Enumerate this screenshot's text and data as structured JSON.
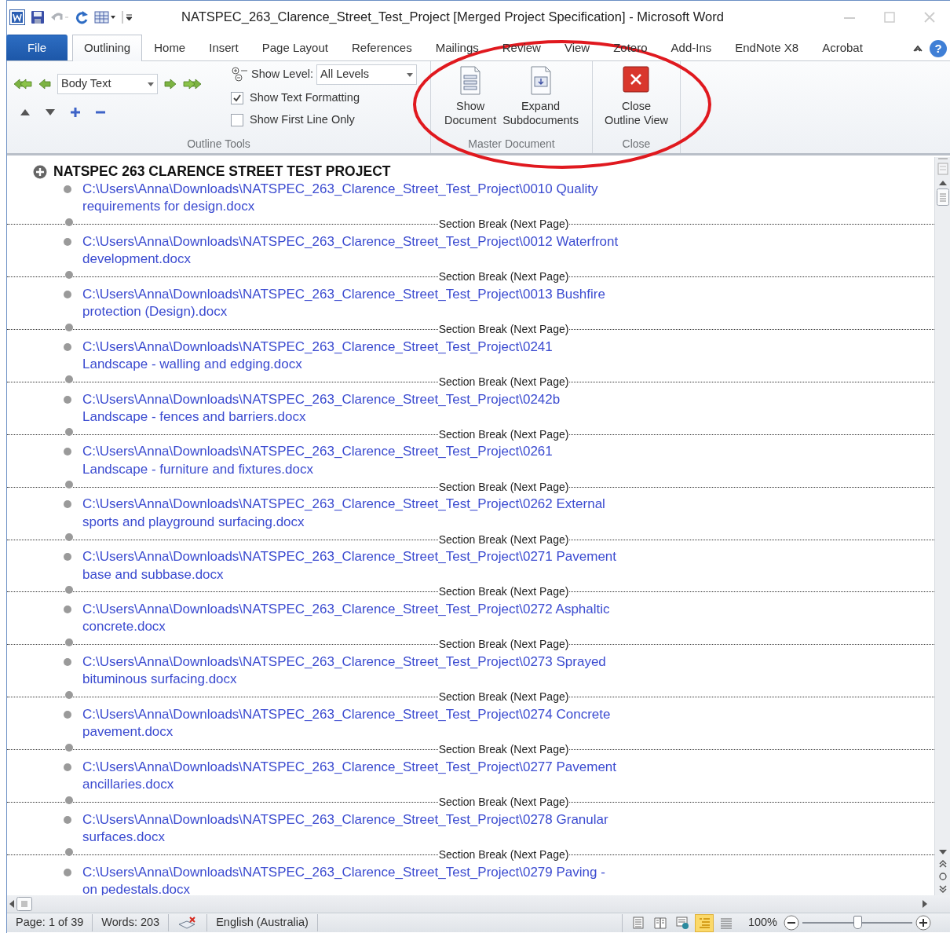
{
  "window": {
    "title": "NATSPEC_263_Clarence_Street_Test_Project [Merged Project Specification]  -  Microsoft Word"
  },
  "tabs": [
    {
      "label": "File",
      "kind": "file",
      "selected": false
    },
    {
      "label": "Outlining",
      "kind": "tab",
      "selected": true
    },
    {
      "label": "Home",
      "kind": "tab",
      "selected": false
    },
    {
      "label": "Insert",
      "kind": "tab",
      "selected": false
    },
    {
      "label": "Page Layout",
      "kind": "tab",
      "selected": false
    },
    {
      "label": "References",
      "kind": "tab",
      "selected": false
    },
    {
      "label": "Mailings",
      "kind": "tab",
      "selected": false
    },
    {
      "label": "Review",
      "kind": "tab",
      "selected": false
    },
    {
      "label": "View",
      "kind": "tab",
      "selected": false
    },
    {
      "label": "Zotero",
      "kind": "tab",
      "selected": false
    },
    {
      "label": "Add-Ins",
      "kind": "tab",
      "selected": false
    },
    {
      "label": "EndNote X8",
      "kind": "tab",
      "selected": false
    },
    {
      "label": "Acrobat",
      "kind": "tab",
      "selected": false
    }
  ],
  "help_button": {
    "label": "?"
  },
  "outline_tools": {
    "style_box": {
      "value": "Body Text"
    },
    "show_level": {
      "label": "Show Level:",
      "value": "All Levels"
    },
    "checkboxes": [
      {
        "label": "Show Text Formatting",
        "checked": true
      },
      {
        "label": "Show First Line Only",
        "checked": false
      }
    ],
    "group_label": "Outline Tools"
  },
  "master_document": {
    "buttons": [
      "Show\nDocument",
      "Expand\nSubdocuments"
    ],
    "group_label": "Master Document"
  },
  "close_group": {
    "buttons": [
      "Close\nOutline View"
    ],
    "group_label": "Close"
  },
  "document": {
    "heading": "NATSPEC 263 CLARENCE STREET TEST PROJECT",
    "items": [
      {
        "text": "C:\\Users\\Anna\\Downloads\\NATSPEC_263_Clarence_Street_Test_Project\\0010 Quality\nrequirements for design.docx",
        "section_break": "Section Break (Next Page)"
      },
      {
        "text": "C:\\Users\\Anna\\Downloads\\NATSPEC_263_Clarence_Street_Test_Project\\0012 Waterfront\ndevelopment.docx",
        "section_break": "Section Break (Next Page)"
      },
      {
        "text": "C:\\Users\\Anna\\Downloads\\NATSPEC_263_Clarence_Street_Test_Project\\0013 Bushfire\nprotection (Design).docx",
        "section_break": "Section Break (Next Page)"
      },
      {
        "text": "C:\\Users\\Anna\\Downloads\\NATSPEC_263_Clarence_Street_Test_Project\\0241\nLandscape - walling and edging.docx",
        "section_break": "Section Break (Next Page)"
      },
      {
        "text": "C:\\Users\\Anna\\Downloads\\NATSPEC_263_Clarence_Street_Test_Project\\0242b\nLandscape - fences and barriers.docx",
        "section_break": "Section Break (Next Page)"
      },
      {
        "text": "C:\\Users\\Anna\\Downloads\\NATSPEC_263_Clarence_Street_Test_Project\\0261\nLandscape - furniture and fixtures.docx",
        "section_break": "Section Break (Next Page)"
      },
      {
        "text": "C:\\Users\\Anna\\Downloads\\NATSPEC_263_Clarence_Street_Test_Project\\0262 External\nsports and playground surfacing.docx",
        "section_break": "Section Break (Next Page)"
      },
      {
        "text": "C:\\Users\\Anna\\Downloads\\NATSPEC_263_Clarence_Street_Test_Project\\0271 Pavement\nbase and subbase.docx",
        "section_break": "Section Break (Next Page)"
      },
      {
        "text": "C:\\Users\\Anna\\Downloads\\NATSPEC_263_Clarence_Street_Test_Project\\0272 Asphaltic\nconcrete.docx",
        "section_break": "Section Break (Next Page)"
      },
      {
        "text": "C:\\Users\\Anna\\Downloads\\NATSPEC_263_Clarence_Street_Test_Project\\0273 Sprayed\nbituminous surfacing.docx",
        "section_break": "Section Break (Next Page)"
      },
      {
        "text": "C:\\Users\\Anna\\Downloads\\NATSPEC_263_Clarence_Street_Test_Project\\0274 Concrete\npavement.docx",
        "section_break": "Section Break (Next Page)"
      },
      {
        "text": "C:\\Users\\Anna\\Downloads\\NATSPEC_263_Clarence_Street_Test_Project\\0277 Pavement\nancillaries.docx",
        "section_break": "Section Break (Next Page)"
      },
      {
        "text": "C:\\Users\\Anna\\Downloads\\NATSPEC_263_Clarence_Street_Test_Project\\0278 Granular\nsurfaces.docx",
        "section_break": "Section Break (Next Page)"
      },
      {
        "text": "C:\\Users\\Anna\\Downloads\\NATSPEC_263_Clarence_Street_Test_Project\\0279 Paving -\non pedestals.docx"
      }
    ]
  },
  "status_bar": {
    "page": "Page: 1 of 39",
    "words": "Words: 203",
    "language": "English (Australia)",
    "views": [
      {
        "selected": false
      },
      {
        "selected": false
      },
      {
        "selected": false
      },
      {
        "selected": true
      },
      {
        "selected": false
      }
    ],
    "zoom": "100%",
    "zoom_slider": {
      "level": 0.5
    }
  }
}
